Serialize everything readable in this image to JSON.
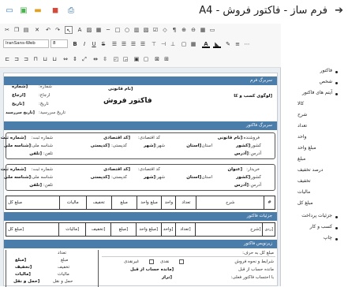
{
  "titlebar": {
    "title": "فرم ساز - فاکتور فروش - A4",
    "icons": [
      "back-arrow-icon",
      "print-icon",
      "print-settings-icon",
      "export-icon",
      "save-icon",
      "new-icon"
    ]
  },
  "toolbar": {
    "font_name": "IranSans-Web",
    "font_size": "8"
  },
  "report": {
    "header_band": "سربرگ فرم",
    "logo_field": "[لوگوی کسب و کا",
    "title": "فاکتور فروش",
    "legal_name_field": "[نام قانونی",
    "number_label": "شماره:",
    "number_field": "[شماره",
    "reference_label": "ارجاع:",
    "reference_field": "[ارجاع",
    "date_label": "تاریخ:",
    "date_field": "[تاریخ",
    "due_label": "تاریخ سررسید:",
    "due_field": "[تاریخ سررسید",
    "invoice_band": "سربرگ فاکتور",
    "seller": {
      "seller_label": "فروشنده:",
      "seller_field": "[نام قانونی",
      "econ_label": "کد اقتصادی:",
      "econ_field": "[کد اقتصادی",
      "reg_label": "شماره ثبت:",
      "reg_field": "[شماره ثبت",
      "country_label": "کشور:",
      "country_field": "[کشور",
      "province_label": "استان:",
      "province_field": "[استان",
      "city_label": "شهر:",
      "city_field": "[شهر",
      "postal_label": "کدپستی:",
      "postal_field": "[کدپستی",
      "national_label": "شناسه ملی:",
      "national_field": "[شناسه ملی",
      "address_label": "آدرس:",
      "address_field": "[آدرس",
      "phone_label": "تلفن:",
      "phone_field": "[تلفن"
    },
    "buyer": {
      "buyer_label": "خریدار:",
      "buyer_field": "[عنوان",
      "econ_label": "کد اقتصادی:",
      "econ_field": "[کد اقتصادی",
      "reg_label": "شماره ثبت:",
      "reg_field": "[شماره ثبت",
      "country_label": "کشور:",
      "country_field": "[کشور",
      "province_label": "استان:",
      "province_field": "[استان",
      "city_label": "شهر:",
      "city_field": "[شهر",
      "postal_label": "کدپستی:",
      "postal_field": "[کدپستی",
      "national_label": "شناسه ملی:",
      "national_field": "[شناسه ملی",
      "address_label": "آدرس:",
      "address_field": "[آدرس",
      "phone_label": "تلفن:",
      "phone_field": "[تلفن"
    },
    "table": {
      "headers": [
        "#",
        "شرح",
        "تعداد",
        "واحد",
        "مبلغ واحد",
        "مبلغ",
        "تخفیف",
        "مالیات",
        "مبلغ کل"
      ],
      "row": [
        "[ردی",
        "[شرح",
        "[تعداد",
        "[واحد",
        "[مبلغ واحد",
        "[مبلغ",
        "[تخفیف",
        "[مالیات",
        "[مبلغ کل"
      ]
    },
    "details_band": "جزئیات فاکتور",
    "footer_band": "زیرنویس فاکتور",
    "amount_words_label": "مبلغ کل به حرف:",
    "terms_label": "شرایط و نحوه فروش",
    "cash_label": "نقدی",
    "credit_label": "غیرنقدی",
    "remaining_label": "مانده حساب از قبل",
    "remaining_field": "[مانده حساب از قبل",
    "balance_label": "با احتساب فاکتور فعلی:",
    "balance_field": "[تراز",
    "totals": [
      {
        "label": "تعداد",
        "field": ""
      },
      {
        "label": "مبلغ",
        "field": "[مبلغ"
      },
      {
        "label": "تخفیف",
        "field": "[تخفیف"
      },
      {
        "label": "مالیات",
        "field": "[مالیات"
      },
      {
        "label": "حمل و نقل",
        "field": "[حمل و نقل"
      }
    ]
  },
  "sidebar": {
    "items": [
      {
        "label": "فاکتور",
        "bullet": true
      },
      {
        "label": "شخص",
        "bullet": true
      },
      {
        "label": "آیتم های فاکتور",
        "bullet": true
      },
      {
        "label": "کالا",
        "bullet": false
      },
      {
        "label": "شرح",
        "bullet": false
      },
      {
        "label": "تعداد",
        "bullet": false
      },
      {
        "label": "واحد",
        "bullet": false
      },
      {
        "label": "مبلغ واحد",
        "bullet": false
      },
      {
        "label": "مبلغ",
        "bullet": false
      },
      {
        "label": "درصد تخفیف",
        "bullet": false
      },
      {
        "label": "تخفیف",
        "bullet": false
      },
      {
        "label": "مالیات",
        "bullet": false
      },
      {
        "label": "مبلغ کل",
        "bullet": false
      },
      {
        "label": "جزئیات پرداخت",
        "bullet": true
      },
      {
        "label": "کسب و کار",
        "bullet": true
      },
      {
        "label": "چاپ",
        "bullet": true
      }
    ]
  }
}
